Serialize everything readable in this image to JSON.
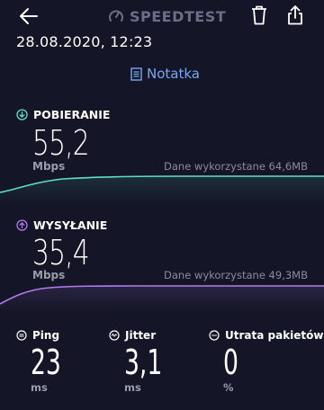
{
  "header": {
    "brand": "SPEEDTEST",
    "icons": [
      "back-arrow-icon",
      "speedtest-logo-icon",
      "trash-icon",
      "share-icon"
    ]
  },
  "result": {
    "datetime": "28.08.2020, 12:23",
    "note_label": "Notatka"
  },
  "download": {
    "label": "POBIERANIE",
    "value": "55,2",
    "unit": "Mbps",
    "data_used": "Dane wykorzystane 64,6MB",
    "color": "#5ee0c8"
  },
  "upload": {
    "label": "WYSYŁANIE",
    "value": "35,4",
    "unit": "Mbps",
    "data_used": "Dane wykorzystane 49,3MB",
    "color": "#b07cf0"
  },
  "ping": {
    "label": "Ping",
    "value": "23",
    "unit": "ms"
  },
  "jitter": {
    "label": "Jitter",
    "value": "3,1",
    "unit": "ms"
  },
  "packet_loss": {
    "label": "Utrata pakietów",
    "value": "0",
    "unit": "%"
  },
  "colors": {
    "background": "#141526",
    "accent_blue": "#7aa6f0",
    "muted_text": "#8a8c9c"
  }
}
